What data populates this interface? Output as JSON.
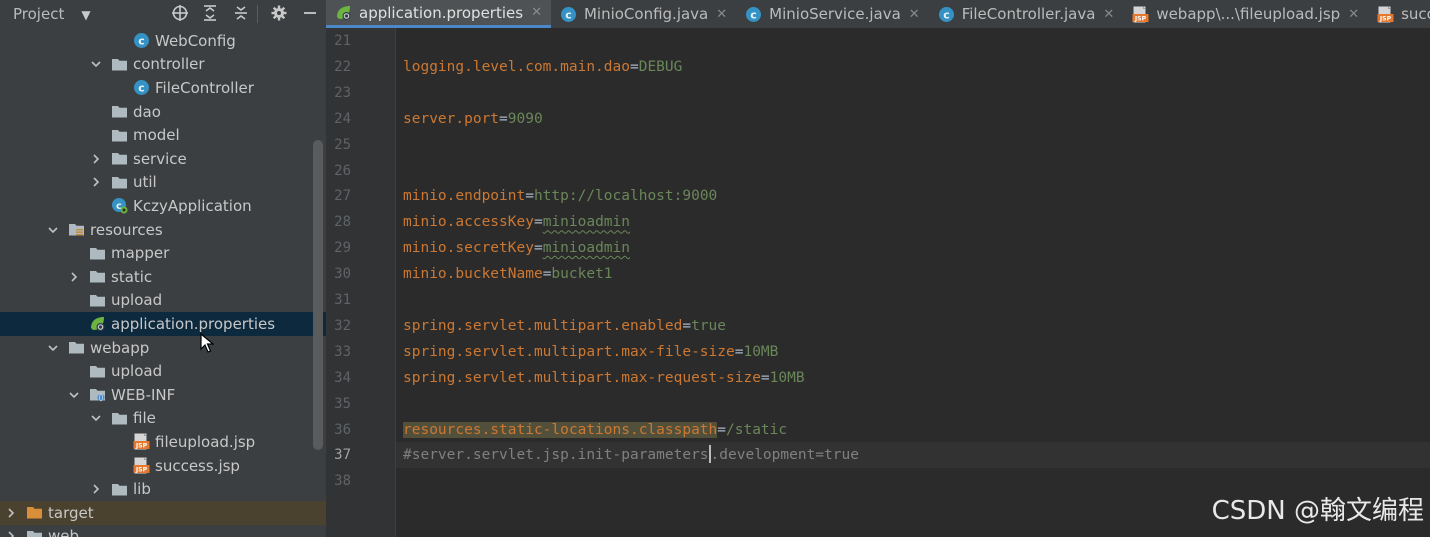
{
  "project_panel": {
    "title": "Project",
    "tree": [
      {
        "label": "WebConfig",
        "icon": "java-class-icon",
        "indent": 133,
        "arrow": "none"
      },
      {
        "label": "controller",
        "icon": "folder-icon",
        "indent": 90,
        "arrow": "down"
      },
      {
        "label": "FileController",
        "icon": "java-class-icon",
        "indent": 133,
        "arrow": "none"
      },
      {
        "label": "dao",
        "icon": "folder-icon",
        "indent": 111,
        "arrow": "none"
      },
      {
        "label": "model",
        "icon": "folder-icon",
        "indent": 111,
        "arrow": "none"
      },
      {
        "label": "service",
        "icon": "folder-icon",
        "indent": 90,
        "arrow": "right"
      },
      {
        "label": "util",
        "icon": "folder-icon",
        "indent": 90,
        "arrow": "right"
      },
      {
        "label": "KczyApplication",
        "icon": "spring-boot-class-icon",
        "indent": 111,
        "arrow": "none"
      },
      {
        "label": "resources",
        "icon": "resources-folder-icon",
        "indent": 47,
        "arrow": "down"
      },
      {
        "label": "mapper",
        "icon": "folder-icon",
        "indent": 89,
        "arrow": "none"
      },
      {
        "label": "static",
        "icon": "folder-icon",
        "indent": 68,
        "arrow": "right"
      },
      {
        "label": "upload",
        "icon": "folder-icon",
        "indent": 89,
        "arrow": "none"
      },
      {
        "label": "application.properties",
        "icon": "spring-properties-icon",
        "indent": 89,
        "arrow": "none",
        "selected": true
      },
      {
        "label": "webapp",
        "icon": "folder-icon",
        "indent": 47,
        "arrow": "down"
      },
      {
        "label": "upload",
        "icon": "folder-icon",
        "indent": 89,
        "arrow": "none"
      },
      {
        "label": "WEB-INF",
        "icon": "web-inf-folder-icon",
        "indent": 68,
        "arrow": "down"
      },
      {
        "label": "file",
        "icon": "folder-icon",
        "indent": 90,
        "arrow": "down"
      },
      {
        "label": "fileupload.jsp",
        "icon": "jsp-file-icon",
        "indent": 133,
        "arrow": "none"
      },
      {
        "label": "success.jsp",
        "icon": "jsp-file-icon",
        "indent": 133,
        "arrow": "none"
      },
      {
        "label": "lib",
        "icon": "folder-icon",
        "indent": 90,
        "arrow": "right"
      },
      {
        "label": "target",
        "icon": "orange-folder-icon",
        "indent": 5,
        "arrow": "right",
        "dark": true
      },
      {
        "label": "web",
        "icon": "folder-icon",
        "indent": 5,
        "arrow": "right"
      }
    ]
  },
  "tabs": [
    {
      "label": "application.properties",
      "icon": "spring-properties-icon",
      "active": true
    },
    {
      "label": "MinioConfig.java",
      "icon": "java-class-icon"
    },
    {
      "label": "MinioService.java",
      "icon": "java-class-icon"
    },
    {
      "label": "FileController.java",
      "icon": "java-class-icon"
    },
    {
      "label": "webapp\\...\\fileupload.jsp",
      "icon": "jsp-file-icon"
    },
    {
      "label": "success.jsp",
      "icon": "jsp-file-icon"
    }
  ],
  "editor": {
    "current_line": 37,
    "lines": [
      {
        "n": "21",
        "key": "",
        "value": ""
      },
      {
        "n": "22",
        "key": "logging.level.com.main.dao",
        "value": "DEBUG"
      },
      {
        "n": "23",
        "key": "",
        "value": ""
      },
      {
        "n": "24",
        "key": "server.port",
        "value": "9090"
      },
      {
        "n": "25",
        "key": "",
        "value": ""
      },
      {
        "n": "26",
        "key": "",
        "value": ""
      },
      {
        "n": "27",
        "key": "minio.endpoint",
        "value": "http://localhost:9000"
      },
      {
        "n": "28",
        "key": "minio.accessKey",
        "value": "minioadmin",
        "typo": true
      },
      {
        "n": "29",
        "key": "minio.secretKey",
        "value": "minioadmin",
        "typo": true
      },
      {
        "n": "30",
        "key": "minio.bucketName",
        "value": "bucket1"
      },
      {
        "n": "31",
        "key": "",
        "value": ""
      },
      {
        "n": "32",
        "key": "spring.servlet.multipart.enabled",
        "value": "true"
      },
      {
        "n": "33",
        "key": "spring.servlet.multipart.max-file-size",
        "value": "10MB"
      },
      {
        "n": "34",
        "key": "spring.servlet.multipart.max-request-size",
        "value": "10MB"
      },
      {
        "n": "35",
        "key": "",
        "value": ""
      },
      {
        "n": "36",
        "key": "resources.static-locations.classpath",
        "value": "/static",
        "highlight_key": true
      },
      {
        "n": "37",
        "comment_before_caret": "#server.servlet.jsp.init-parameters",
        "comment_after_caret": ".development=true"
      },
      {
        "n": "38",
        "key": "",
        "value": ""
      }
    ]
  },
  "watermark": "CSDN @翰文编程",
  "colors": {
    "key": "#cc7832",
    "value": "#6a8759",
    "comment": "#808080",
    "selection": "#0d293e",
    "tab_underline": "#4a88c7"
  }
}
